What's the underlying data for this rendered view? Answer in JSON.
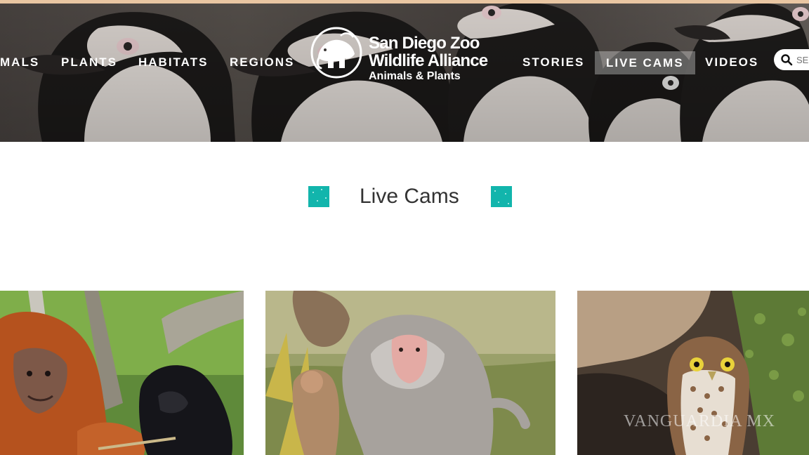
{
  "nav": {
    "left_items": [
      {
        "label": "MALS"
      },
      {
        "label": "PLANTS"
      },
      {
        "label": "HABITATS"
      },
      {
        "label": "REGIONS"
      }
    ],
    "right_items": [
      {
        "label": "STORIES"
      },
      {
        "label": "LIVE CAMS",
        "active": true
      },
      {
        "label": "VIDEOS"
      }
    ],
    "search_placeholder": "SE"
  },
  "logo": {
    "line1": "San Diego Zoo",
    "line2": "Wildlife Alliance",
    "line3": "Animals & Plants",
    "icon": "elephant-in-circle-logo-icon"
  },
  "page": {
    "title": "Live Cams"
  },
  "cards": [
    {
      "subject": "orangutan-and-siamang-photo"
    },
    {
      "subject": "baboon-photo"
    },
    {
      "subject": "burrowing-owl-photo"
    }
  ],
  "watermark": "VANGUARDIA MX",
  "colors": {
    "accent_teal": "#12b5ac",
    "nav_text": "#ffffff",
    "title_text": "#333333",
    "top_line": "#e9c6a2"
  }
}
